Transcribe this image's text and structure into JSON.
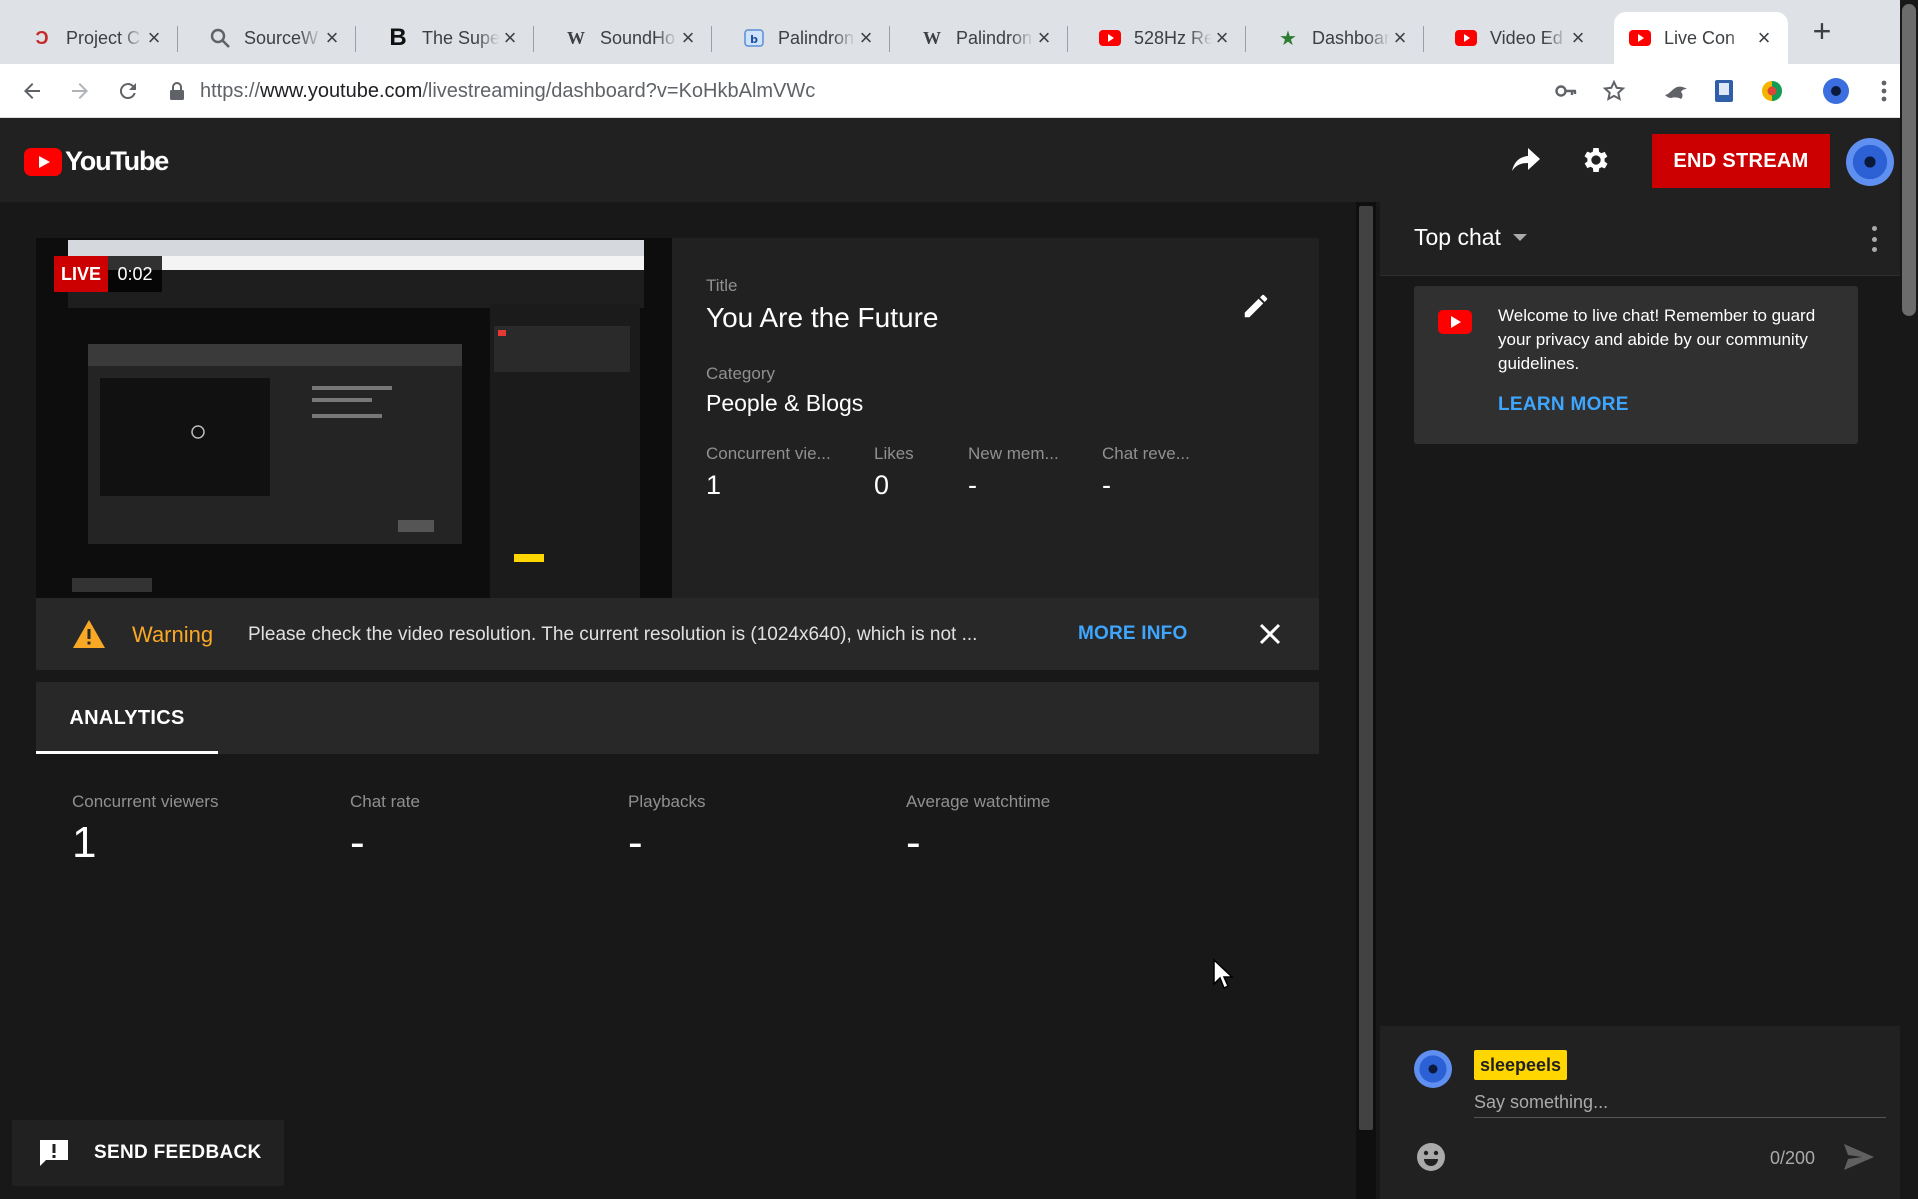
{
  "browser": {
    "tabs": [
      {
        "label": "Project C",
        "favicon": "project-c-icon",
        "active": false
      },
      {
        "label": "SourceW",
        "favicon": "search-icon",
        "active": false
      },
      {
        "label": "The Supe",
        "favicon": "bold-b-icon",
        "active": false
      },
      {
        "label": "SoundHo",
        "favicon": "wikipedia-icon",
        "active": false
      },
      {
        "label": "Palindron",
        "favicon": "palindrome-icon",
        "active": false
      },
      {
        "label": "Palindron",
        "favicon": "wikipedia-icon",
        "active": false
      },
      {
        "label": "528Hz Re",
        "favicon": "youtube-icon",
        "active": false
      },
      {
        "label": "Dashboar",
        "favicon": "star-icon",
        "active": false
      },
      {
        "label": "Video Ed",
        "favicon": "youtube-icon",
        "active": false
      },
      {
        "label": "Live Con",
        "favicon": "youtube-icon",
        "active": true
      }
    ],
    "url_prefix": "https://",
    "url_host": "www.youtube.com",
    "url_path": "/livestreaming/dashboard?v=KoHkbAlmVWc"
  },
  "header": {
    "logo_text": "YouTube",
    "end_stream_label": "END STREAM"
  },
  "stream": {
    "live_label": "LIVE",
    "elapsed": "0:02",
    "title_label": "Title",
    "title": "You Are the Future",
    "category_label": "Category",
    "category": "People & Blogs",
    "stats": [
      {
        "label": "Concurrent vie...",
        "value": "1"
      },
      {
        "label": "Likes",
        "value": "0"
      },
      {
        "label": "New mem...",
        "value": "-"
      },
      {
        "label": "Chat reve...",
        "value": "-"
      }
    ]
  },
  "warning": {
    "title": "Warning",
    "text": "Please check the video resolution. The current resolution is (1024x640), which is not ...",
    "more_info": "MORE INFO"
  },
  "analytics": {
    "tab_label": "ANALYTICS",
    "stats": [
      {
        "label": "Concurrent viewers",
        "value": "1"
      },
      {
        "label": "Chat rate",
        "value": "-"
      },
      {
        "label": "Playbacks",
        "value": "-"
      },
      {
        "label": "Average watchtime",
        "value": "-"
      }
    ]
  },
  "feedback": {
    "label": "SEND FEEDBACK"
  },
  "chat": {
    "mode_label": "Top chat",
    "welcome_text": "Welcome to live chat! Remember to guard your privacy and abide by our community guidelines.",
    "learn_more": "LEARN MORE",
    "username": "sleepeels",
    "input_placeholder": "Say something...",
    "char_count": "0/200"
  },
  "colors": {
    "accent_red": "#cc0000",
    "link_blue": "#3ea6ff",
    "warning_yellow": "#f9a825",
    "username_badge": "#ffd600"
  }
}
